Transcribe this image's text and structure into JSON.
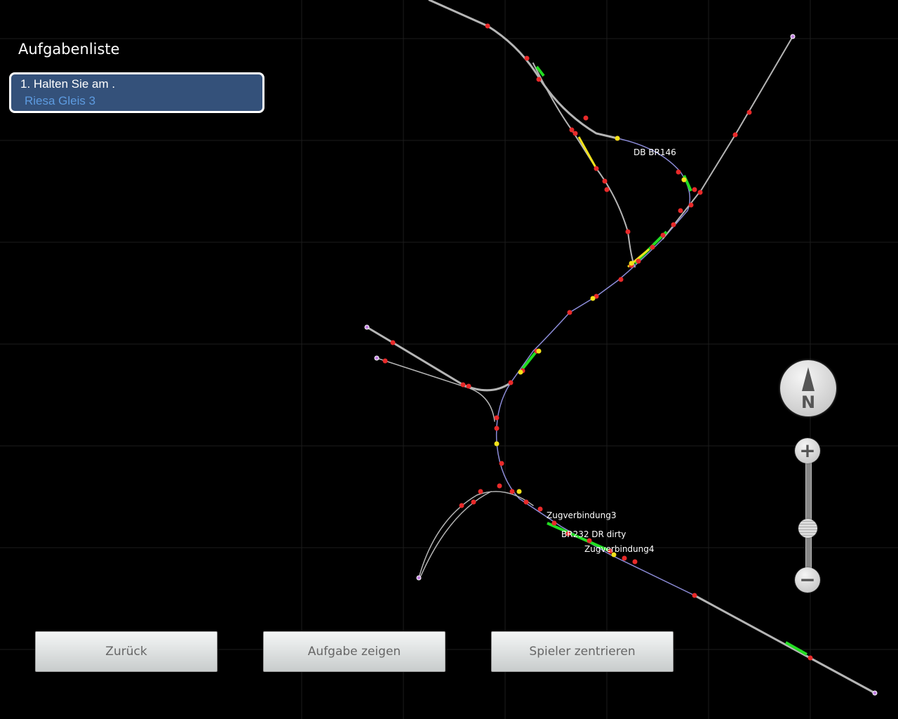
{
  "sidebar": {
    "title": "Aufgabenliste",
    "tasks": [
      {
        "line1": "1. Halten Sie am .",
        "line2": "Riesa Gleis 3"
      }
    ]
  },
  "buttons": {
    "back": "Zurück",
    "show_task": "Aufgabe zeigen",
    "center_player": "Spieler zentrieren"
  },
  "map": {
    "labels": {
      "train1": "DB BR146",
      "train2": "Zugverbindung3",
      "train3": "BR232 DR dirty",
      "train4": "Zugverbindung4"
    },
    "compass_label": "N",
    "zoom_level": 0.4,
    "colors": {
      "track": "#b5b5b5",
      "signal": "#e82a2a",
      "occupied": "#22dd22",
      "warning": "#f2e21a",
      "endpoint": "#c080e0"
    }
  },
  "zoom": {
    "in": "+",
    "out": "−"
  }
}
